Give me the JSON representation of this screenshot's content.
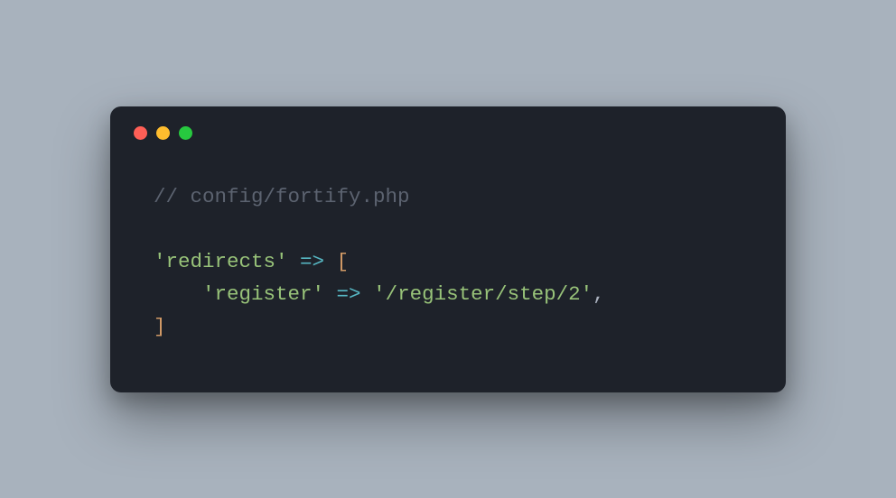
{
  "window": {
    "traffic_lights": {
      "red": "#ff5f56",
      "yellow": "#ffbd2e",
      "green": "#27c93f"
    }
  },
  "code": {
    "comment_prefix": "// ",
    "comment_text": "config/fortify.php",
    "key_redirects": "'redirects'",
    "arrow": " => ",
    "open_bracket": "[",
    "indent": "    ",
    "key_register": "'register'",
    "value_register": "'/register/step/2'",
    "comma": ",",
    "close_bracket": "]"
  }
}
